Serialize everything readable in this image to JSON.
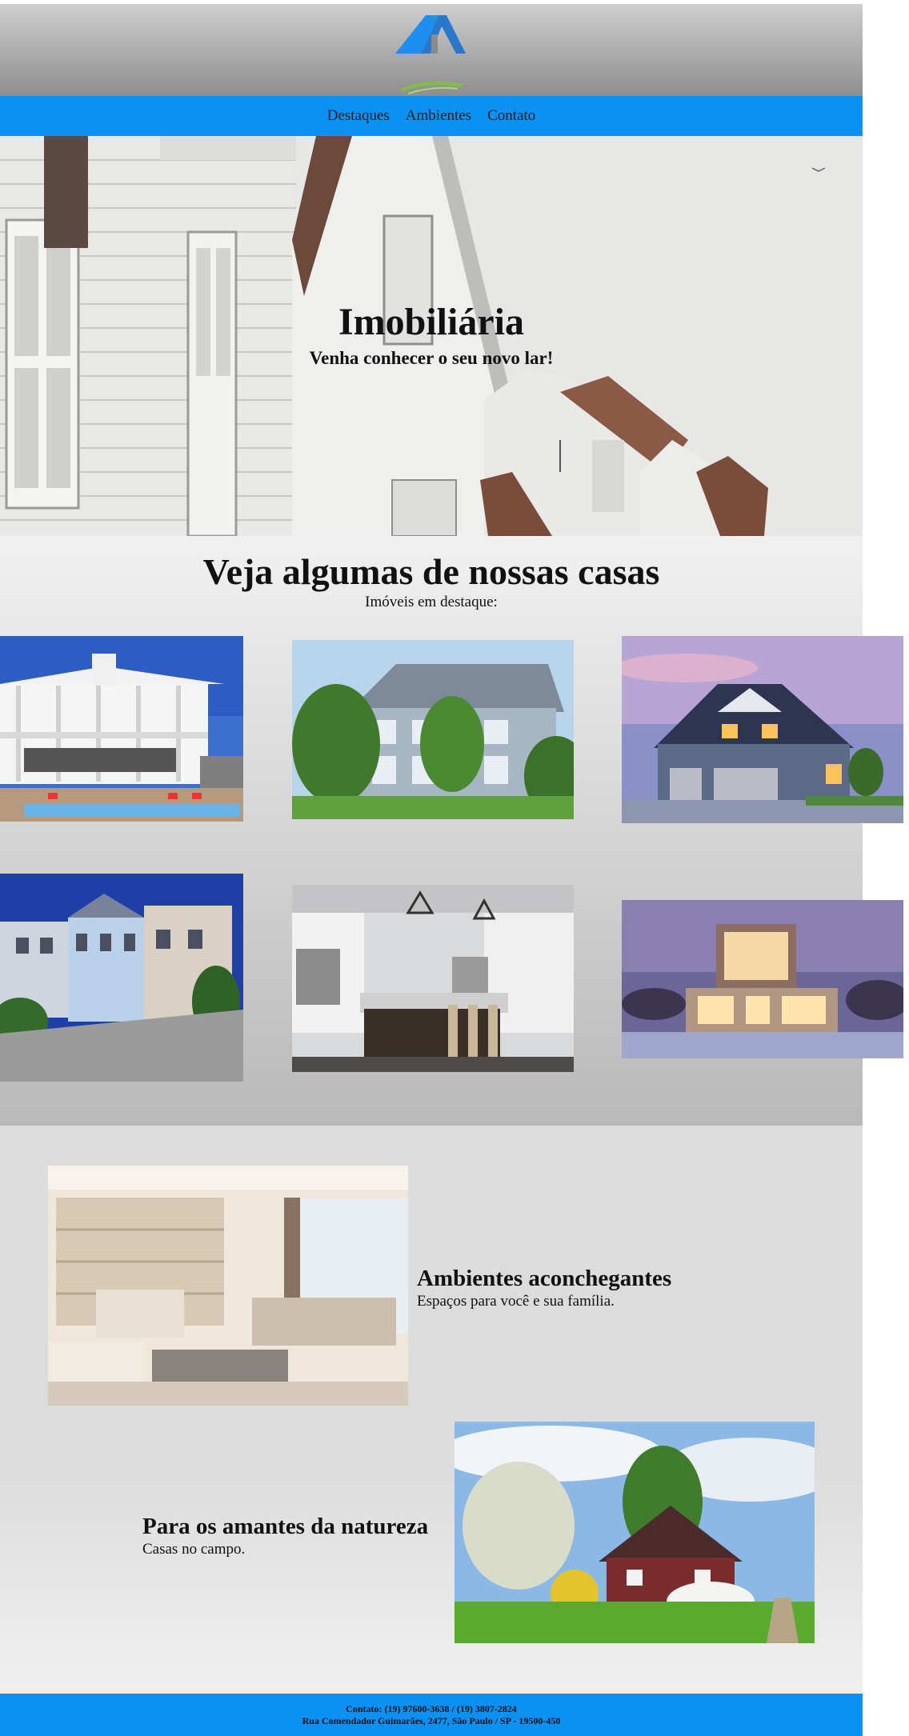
{
  "brand": {
    "logo_icon": "house-roof-logo-icon"
  },
  "nav": {
    "items": [
      {
        "label": "Destaques"
      },
      {
        "label": "Ambientes"
      },
      {
        "label": "Contato"
      }
    ]
  },
  "hero": {
    "title": "Imobiliária",
    "subtitle": "Venha conhecer o seu novo lar!"
  },
  "featured": {
    "title": "Veja algumas de nossas casas",
    "subtitle": "Imóveis em destaque:"
  },
  "ambientes": [
    {
      "title": "Ambientes aconchegantes",
      "text": "Espaços para você e sua família."
    },
    {
      "title": "Para os amantes da natureza",
      "text": "Casas no campo."
    }
  ],
  "footer": {
    "contact": "Contato: (19) 97600-3638 / (19) 3807-2824",
    "address": "Rua Comendador Guimarães, 2477, São Paulo / SP - 19500-450"
  },
  "colors": {
    "nav": "#0b90f4",
    "footer": "#0b90f4",
    "header_gradient_top": "#cfcfcf",
    "header_gradient_bottom": "#8f8d8f"
  }
}
